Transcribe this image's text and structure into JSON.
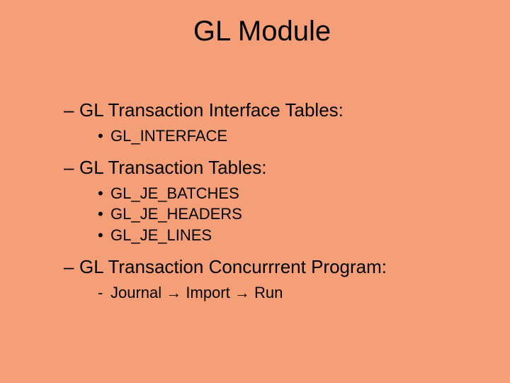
{
  "title": "GL Module",
  "sections": [
    {
      "heading": "GL Transaction Interface Tables:",
      "bullet_char": "•",
      "items": [
        "GL_INTERFACE"
      ]
    },
    {
      "heading": "GL Transaction Tables:",
      "bullet_char": "•",
      "items": [
        "GL_JE_BATCHES",
        "GL_JE_HEADERS",
        "GL_JE_LINES"
      ]
    },
    {
      "heading": "GL Transaction Concurrrent Program:",
      "bullet_char": "-",
      "items": [
        "Journal → Import → Run"
      ]
    }
  ],
  "dash_char": "–"
}
